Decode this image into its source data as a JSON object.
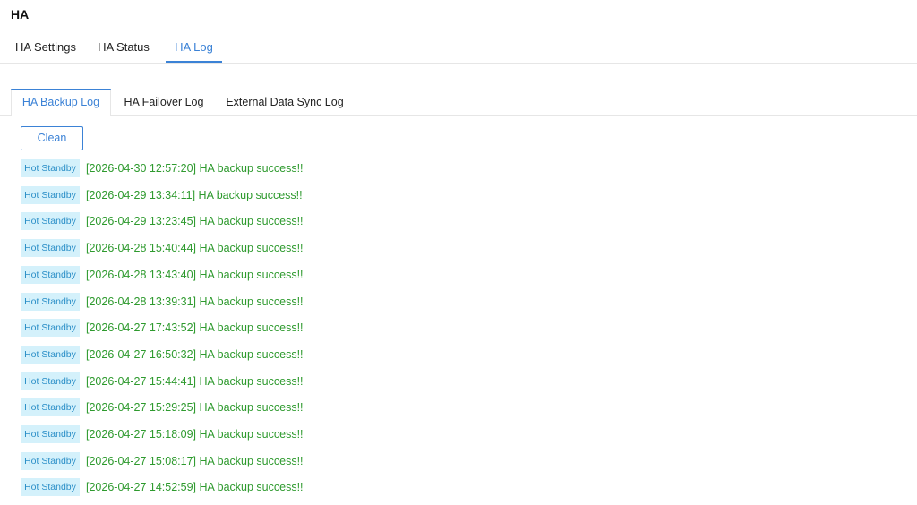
{
  "page": {
    "title": "HA"
  },
  "top_tabs": [
    {
      "label": "HA Settings",
      "active": false
    },
    {
      "label": "HA Status",
      "active": false
    },
    {
      "label": "HA Log",
      "active": true
    }
  ],
  "sub_tabs": [
    {
      "label": "HA Backup Log",
      "active": true
    },
    {
      "label": "HA Failover Log",
      "active": false
    },
    {
      "label": "External Data Sync Log",
      "active": false
    }
  ],
  "toolbar": {
    "clean_label": "Clean"
  },
  "colors": {
    "accent": "#3b82d6",
    "success_text": "#2e9a2e",
    "badge_bg": "#d4f1fb",
    "badge_text": "#2a8ec7"
  },
  "logs": [
    {
      "badge": "Hot Standby",
      "text": "[2026-04-30 12:57:20] HA backup success!!"
    },
    {
      "badge": "Hot Standby",
      "text": "[2026-04-29 13:34:11] HA backup success!!"
    },
    {
      "badge": "Hot Standby",
      "text": "[2026-04-29 13:23:45] HA backup success!!"
    },
    {
      "badge": "Hot Standby",
      "text": "[2026-04-28 15:40:44] HA backup success!!"
    },
    {
      "badge": "Hot Standby",
      "text": "[2026-04-28 13:43:40] HA backup success!!"
    },
    {
      "badge": "Hot Standby",
      "text": "[2026-04-28 13:39:31] HA backup success!!"
    },
    {
      "badge": "Hot Standby",
      "text": "[2026-04-27 17:43:52] HA backup success!!"
    },
    {
      "badge": "Hot Standby",
      "text": "[2026-04-27 16:50:32] HA backup success!!"
    },
    {
      "badge": "Hot Standby",
      "text": "[2026-04-27 15:44:41] HA backup success!!"
    },
    {
      "badge": "Hot Standby",
      "text": "[2026-04-27 15:29:25] HA backup success!!"
    },
    {
      "badge": "Hot Standby",
      "text": "[2026-04-27 15:18:09] HA backup success!!"
    },
    {
      "badge": "Hot Standby",
      "text": "[2026-04-27 15:08:17] HA backup success!!"
    },
    {
      "badge": "Hot Standby",
      "text": "[2026-04-27 14:52:59] HA backup success!!"
    }
  ]
}
